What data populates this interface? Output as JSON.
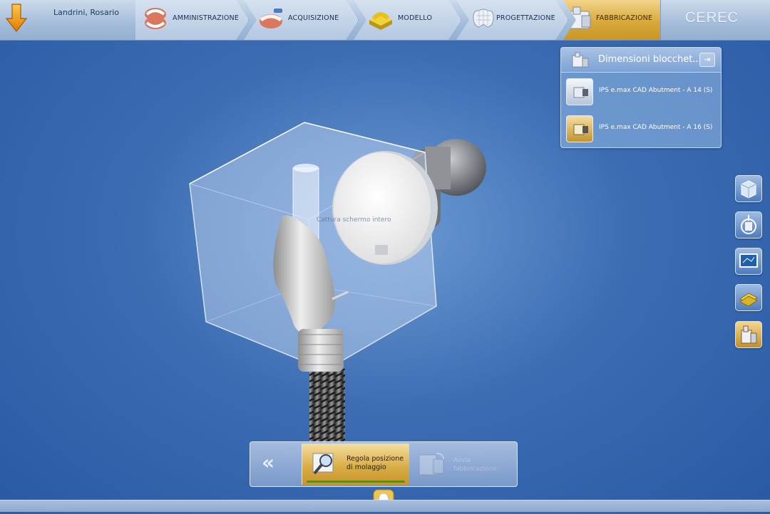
{
  "header": {
    "patient_name": "Landrini, Rosario",
    "brand": "CEREC",
    "steps": [
      {
        "label": "AMMINISTRAZIONE",
        "icon": "dental-arch-icon",
        "active": false
      },
      {
        "label": "ACQUISIZIONE",
        "icon": "scan-jaw-icon",
        "active": false
      },
      {
        "label": "MODELLO",
        "icon": "model-base-icon",
        "active": false
      },
      {
        "label": "PROGETTAZIONE",
        "icon": "crown-design-icon",
        "active": false
      },
      {
        "label": "FABBRICAZIONE",
        "icon": "milling-unit-icon",
        "active": true
      }
    ]
  },
  "block_panel": {
    "title": "Dimensioni blocchet...",
    "items": [
      {
        "label": "IPS e.max CAD Abutment - A 14 (S)",
        "selected": false
      },
      {
        "label": "IPS e.max CAD Abutment - A 16 (S)",
        "selected": true
      }
    ]
  },
  "side_tools": [
    {
      "icon": "cube-view-icon",
      "active": false
    },
    {
      "icon": "restoration-position-icon",
      "active": false
    },
    {
      "icon": "screen-monitor-icon",
      "active": false
    },
    {
      "icon": "tool-settings-icon",
      "active": false
    },
    {
      "icon": "milling-unit-icon",
      "active": true
    }
  ],
  "viewport": {
    "tooltip": "Cattura schermo intero"
  },
  "bottom_toolbar": {
    "back_label": "«",
    "action_label": "Regola posizione di molaggio",
    "next_label": "Avvia fabbricazione"
  },
  "colors": {
    "accent_gold": "#d7ab44",
    "progress_green": "#2fa11e",
    "background_blue": "#3c6db3"
  }
}
